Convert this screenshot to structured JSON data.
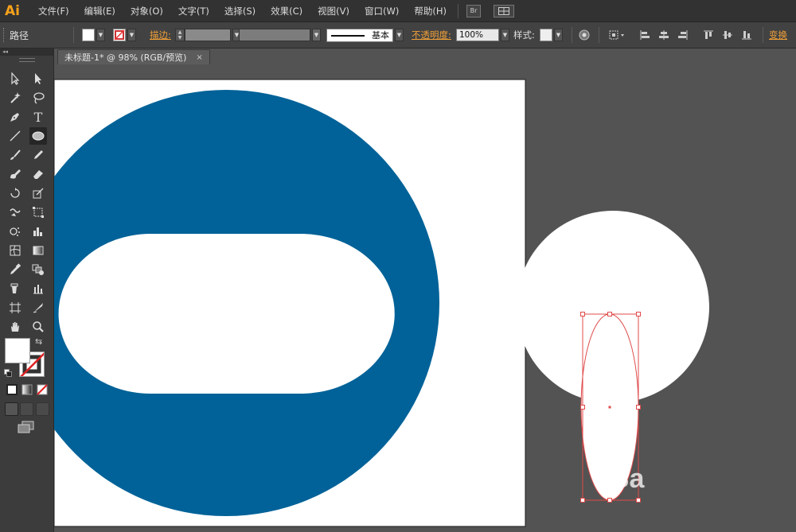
{
  "app": {
    "logo": "Ai"
  },
  "menu": [
    "文件(F)",
    "编辑(E)",
    "对象(O)",
    "文字(T)",
    "选择(S)",
    "效果(C)",
    "视图(V)",
    "窗口(W)",
    "帮助(H)"
  ],
  "menu_buttons": {
    "bridge": "Br"
  },
  "control": {
    "object_type": "路径",
    "stroke_label": "描边:",
    "brush_label": "基本",
    "opacity_label": "不透明度:",
    "opacity_value": "100%",
    "style_label": "样式:",
    "transform_label": "变换"
  },
  "tools_panel": {
    "collapse": "◂◂"
  },
  "document": {
    "tab_title": "未标题-1* @ 98% (RGB/预览)",
    "close": "×"
  },
  "watermark": "Ba",
  "colors": {
    "circle_fill": "#006298",
    "accent": "#f0a038",
    "selection": "#e04a4a"
  },
  "icons": [
    "selection-tool-icon",
    "direct-selection-tool-icon",
    "magic-wand-icon",
    "lasso-icon",
    "pen-tool-icon",
    "type-tool-icon",
    "line-tool-icon",
    "ellipse-tool-icon",
    "paintbrush-icon",
    "pencil-icon",
    "blob-brush-icon",
    "eraser-icon",
    "rotate-icon",
    "scale-icon",
    "warp-icon",
    "free-transform-icon",
    "symbol-sprayer-icon",
    "column-graph-icon",
    "mesh-icon",
    "gradient-icon",
    "eyedropper-icon",
    "blend-icon",
    "artboard-icon",
    "slice-icon",
    "hand-icon",
    "zoom-icon"
  ]
}
